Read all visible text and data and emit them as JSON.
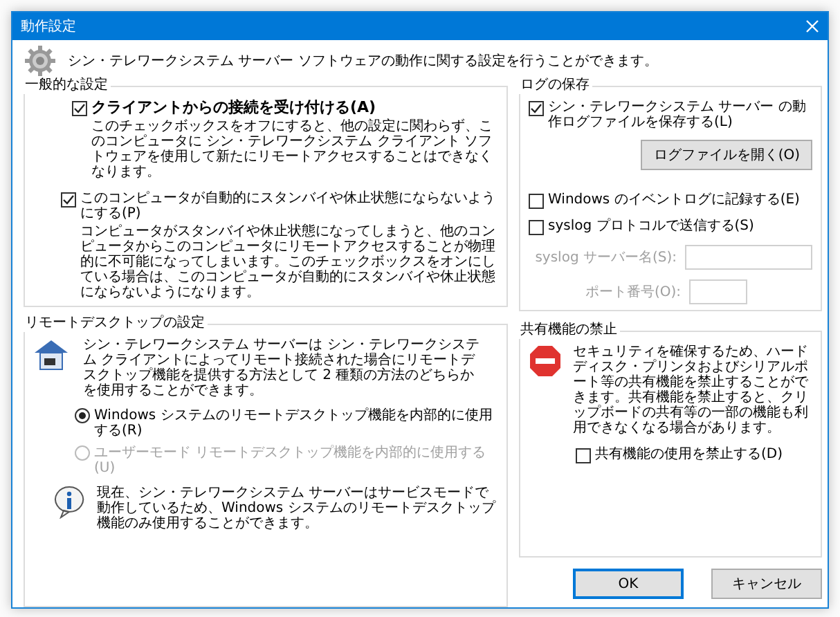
{
  "window": {
    "title": "動作設定"
  },
  "header": {
    "text": "シン・テレワークシステム サーバー ソフトウェアの動作に関する設定を行うことができます。"
  },
  "general": {
    "title": "一般的な設定",
    "options": [
      {
        "kind": "primary",
        "label": "クライアントからの接続を受け付ける(A)",
        "checked": true,
        "description": "このチェックボックスをオフにすると、他の設定に関わらず、このコンピュータに シン・テレワークシステム クライアント ソフトウェアを使用して新たにリモートアクセスすることはできなくなります。"
      },
      {
        "kind": "normal",
        "label": "このコンピュータが自動的にスタンバイや休止状態にならないようにする(P)",
        "checked": true,
        "description": "コンピュータがスタンバイや休止状態になってしまうと、他のコンピュータからこのコンピュータにリモートアクセスすることが物理的に不可能になってしまいます。このチェックボックスをオンにしている場合は、このコンピュータが自動的にスタンバイや休止状態にならないようになります。"
      }
    ]
  },
  "remote_desktop": {
    "title": "リモートデスクトップの設定",
    "intro": "シン・テレワークシステム サーバーは シン・テレワークシステム クライアントによってリモート接続された場合にリモートデスクトップ機能を提供する方法として 2 種類の方法のどちらかを使用することができます。",
    "radios": [
      {
        "label": "Windows システムのリモートデスクトップ機能を内部的に使用する(R)",
        "selected": true,
        "disabled": false
      },
      {
        "label": "ユーザーモード リモートデスクトップ機能を内部的に使用する(U)",
        "selected": false,
        "disabled": true
      }
    ],
    "note": "現在、シン・テレワークシステム サーバーはサービスモードで動作しているため、Windows システムのリモートデスクトップ機能のみ使用することができます。"
  },
  "log": {
    "title": "ログの保存",
    "save": {
      "label": "シン・テレワークシステム サーバー の動作ログファイルを保存する(L)",
      "checked": true
    },
    "open_button": "ログファイルを開く(O)",
    "event_log": {
      "label": "Windows のイベントログに記録する(E)",
      "checked": false
    },
    "syslog": {
      "label": "syslog プロトコルで送信する(S)",
      "checked": false
    },
    "fields_disabled": true,
    "server_label": "syslog サーバー名(S):",
    "port_label": "ポート番号(O):"
  },
  "sharing": {
    "title": "共有機能の禁止",
    "text": "セキュリティを確保するため、ハードディスク・プリンタおよびシリアルポート等の共有機能を禁止することができます。共有機能を禁止すると、クリップボードの共有等の一部の機能も利用できなくなる場合があります。",
    "checkbox": {
      "label": "共有機能の使用を禁止する(D)",
      "checked": false
    }
  },
  "buttons": [
    {
      "label": "OK",
      "default": true
    },
    {
      "label": "キャンセル",
      "default": false
    }
  ]
}
